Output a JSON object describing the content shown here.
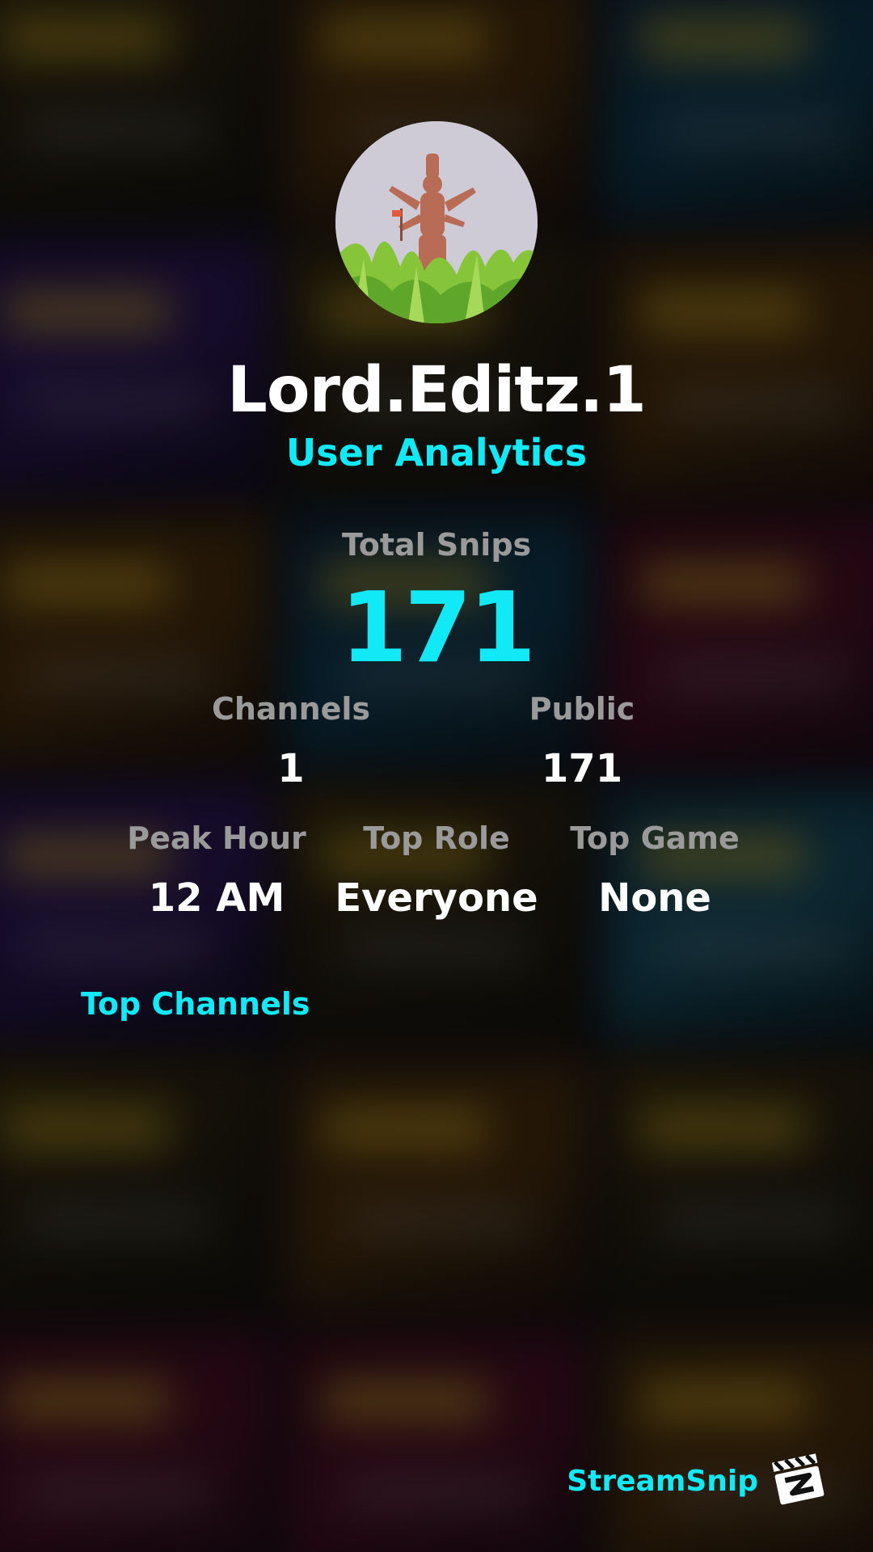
{
  "profile": {
    "username": "Lord.Editz.1",
    "subtitle": "User Analytics"
  },
  "total": {
    "label": "Total Snips",
    "value": "171"
  },
  "stats_row1": [
    {
      "label": "Channels",
      "value": "1"
    },
    {
      "label": "Public",
      "value": "171"
    }
  ],
  "stats_row2": [
    {
      "label": "Peak Hour",
      "value": "12 AM"
    },
    {
      "label": "Top Role",
      "value": "Everyone"
    },
    {
      "label": "Top Game",
      "value": "None"
    }
  ],
  "sections": {
    "top_channels": "Top Channels"
  },
  "brand": {
    "name": "StreamSnip",
    "logo_icon": "clapperboard-icon"
  },
  "colors": {
    "accent": "#12e9f7",
    "label": "#9a9a9a",
    "value": "#ffffff"
  }
}
